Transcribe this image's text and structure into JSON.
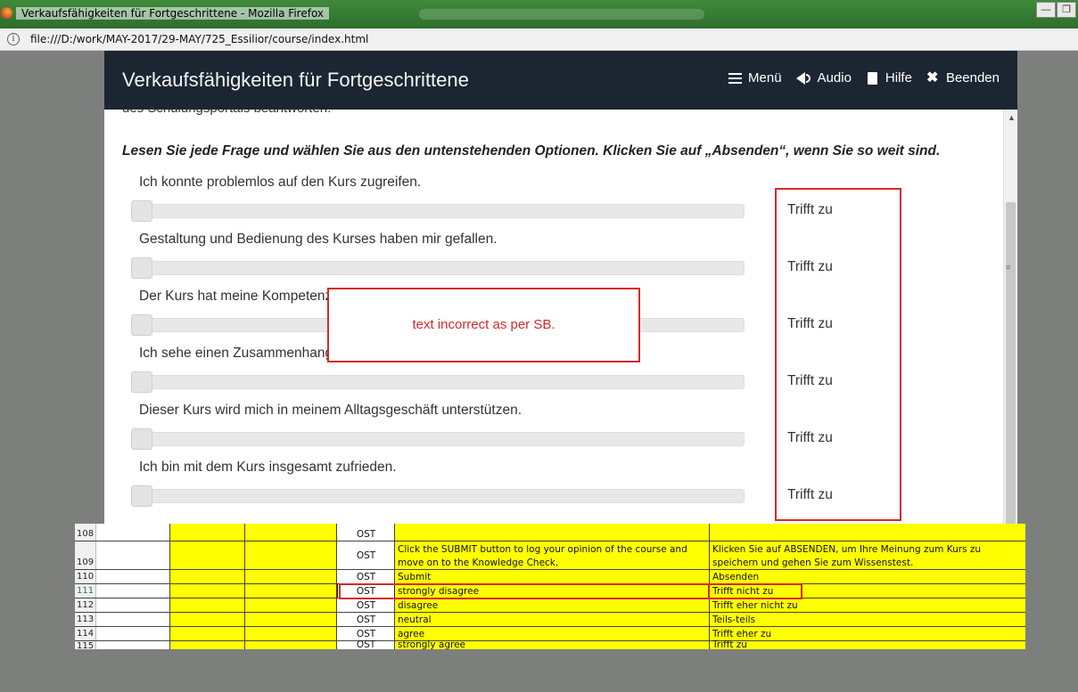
{
  "window": {
    "title": "Verkaufsfähigkeiten für Fortgeschrittene - Mozilla Firefox",
    "url": "file:///D:/work/MAY-2017/29-MAY/725_Essilior/course/index.html",
    "min_btn": "—",
    "restore_btn": "❐"
  },
  "course": {
    "title": "Verkaufsfähigkeiten für Fortgeschrittene",
    "nav": {
      "menu": "Menü",
      "audio": "Audio",
      "help": "Hilfe",
      "exit": "Beenden"
    },
    "cutoff_text": "des Schulungsportals beantworten.",
    "instruction": "Lesen Sie jede Frage und wählen Sie aus den untenstehenden Optionen. Klicken Sie auf „Absenden“, wenn Sie so weit sind.",
    "questions": [
      {
        "label": "Ich konnte problemlos auf den Kurs zugreifen.",
        "value": "Trifft zu"
      },
      {
        "label": "Gestaltung und Bedienung des Kurses haben mir gefallen.",
        "value": "Trifft zu"
      },
      {
        "label": "Der Kurs hat meine Kompetenzen erweitert.",
        "value": "Trifft zu"
      },
      {
        "label": "Ich sehe einen Zusammenhang",
        "value": "Trifft zu"
      },
      {
        "label": "Dieser Kurs wird mich in meinem Alltagsgeschäft unterstützen.",
        "value": "Trifft zu"
      },
      {
        "label": "Ich bin mit dem Kurs insgesamt zufrieden.",
        "value": "Trifft zu"
      }
    ],
    "callout": "text incorrect as per SB."
  },
  "sheet": {
    "rows": [
      {
        "num": "108",
        "ost": "OST",
        "en": "",
        "de": ""
      },
      {
        "num": "109",
        "ost": "OST",
        "en": "Click the SUBMIT button to log your opinion of the course and move on to the Knowledge Check.",
        "de": "Klicken Sie auf ABSENDEN, um Ihre Meinung zum Kurs zu speichern und gehen Sie zum Wissenstest."
      },
      {
        "num": "110",
        "ost": "OST",
        "en": "Submit",
        "de": "Absenden"
      },
      {
        "num": "111",
        "ost": "OST",
        "en": "strongly disagree",
        "de": "Trifft nicht zu"
      },
      {
        "num": "112",
        "ost": "OST",
        "en": "disagree",
        "de": "Trifft eher nicht zu"
      },
      {
        "num": "113",
        "ost": "OST",
        "en": "neutral",
        "de": "Teils-teils"
      },
      {
        "num": "114",
        "ost": "OST",
        "en": "agree",
        "de": "Trifft eher zu"
      },
      {
        "num": "115",
        "ost": "OST",
        "en": "strongly agree",
        "de": "Trifft zu"
      }
    ]
  }
}
